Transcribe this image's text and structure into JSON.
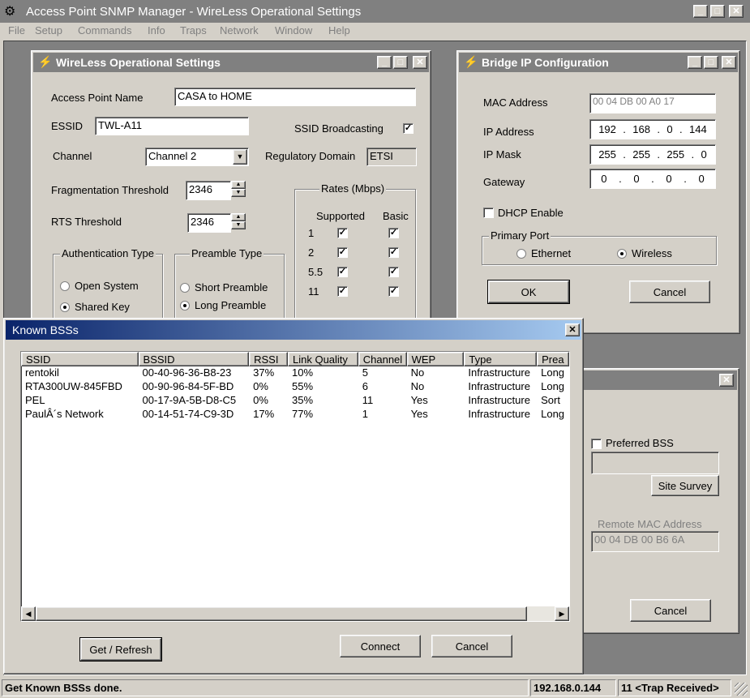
{
  "app": {
    "title": "Access Point SNMP Manager -  WireLess Operational Settings",
    "menu": [
      "File",
      "Setup",
      "Commands",
      "Info",
      "Traps",
      "Network",
      "Window",
      "Help"
    ]
  },
  "wireless": {
    "title": "WireLess Operational Settings",
    "ap_name_label": "Access Point Name",
    "ap_name": "CASA to HOME",
    "essid_label": "ESSID",
    "essid": "TWL-A11",
    "ssid_broadcast_label": "SSID Broadcasting",
    "channel_label": "Channel",
    "channel": "Channel 2",
    "regdomain_label": "Regulatory Domain",
    "regdomain": "ETSI",
    "frag_label": "Fragmentation Threshold",
    "frag": "2346",
    "rts_label": "RTS Threshold",
    "rts": "2346",
    "auth_label": "Authentication Type",
    "auth_open": "Open System",
    "auth_shared": "Shared Key",
    "preamble_label": "Preamble Type",
    "preamble_short": "Short Preamble",
    "preamble_long": "Long Preamble",
    "rates_label": "Rates (Mbps)",
    "supported_label": "Supported",
    "basic_label": "Basic",
    "rates": [
      "1",
      "2",
      "5.5",
      "11"
    ]
  },
  "bridge": {
    "title": "Bridge IP Configuration",
    "mac_label": "MAC Address",
    "mac": "00 04 DB 00 A0 17",
    "ip_label": "IP Address",
    "ip": [
      "192",
      "168",
      "0",
      "144"
    ],
    "mask_label": "IP Mask",
    "mask": [
      "255",
      "255",
      "255",
      "0"
    ],
    "gateway_label": "Gateway",
    "gateway": [
      "0",
      "0",
      "0",
      "0"
    ],
    "dhcp_label": "DHCP Enable",
    "port_label": "Primary Port",
    "ethernet": "Ethernet",
    "wireless": "Wireless",
    "ok": "OK",
    "cancel": "Cancel"
  },
  "back_window": {
    "preferred_label": "Preferred BSS",
    "site_survey": "Site Survey",
    "remote_mac_label": "Remote MAC Address",
    "remote_mac": "00 04 DB 00 B6 6A",
    "cancel": "Cancel"
  },
  "known_bss": {
    "title": "Known BSSs",
    "columns": [
      "SSID",
      "BSSID",
      "RSSI",
      "Link Quality",
      "Channel",
      "WEP",
      "Type",
      "Prea"
    ],
    "rows": [
      [
        "rentokil",
        "00-40-96-36-B8-23",
        "37%",
        "10%",
        "5",
        "No",
        "Infrastructure",
        "Long"
      ],
      [
        "RTA300UW-845FBD",
        "00-90-96-84-5F-BD",
        "0%",
        "55%",
        "6",
        "No",
        "Infrastructure",
        "Long"
      ],
      [
        "PEL",
        "00-17-9A-5B-D8-C5",
        "0%",
        "35%",
        "11",
        "Yes",
        "Infrastructure",
        "Sort"
      ],
      [
        "PaulÂ´s Network",
        "00-14-51-74-C9-3D",
        "17%",
        "77%",
        "1",
        "Yes",
        "Infrastructure",
        "Long"
      ]
    ],
    "get_refresh": "Get / Refresh",
    "connect": "Connect",
    "cancel": "Cancel"
  },
  "status": {
    "message": "Get Known BSSs done.",
    "ip": "192.168.0.144",
    "trap": "11 <Trap Received>"
  }
}
